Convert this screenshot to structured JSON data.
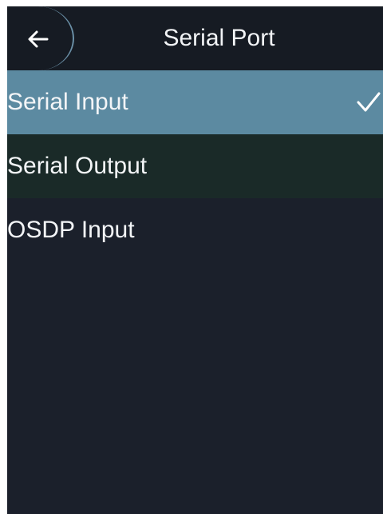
{
  "header": {
    "title": "Serial Port",
    "back_icon": "back-arrow-icon"
  },
  "list": {
    "items": [
      {
        "label": "Serial Input",
        "selected": true
      },
      {
        "label": "Serial Output",
        "selected": false
      },
      {
        "label": "OSDP Input",
        "selected": false
      }
    ],
    "check_icon": "checkmark-icon"
  },
  "colors": {
    "screen_bg": "#1b202b",
    "header_bg": "#161b23",
    "selected_bg": "#5c8aa1",
    "second_row_bg": "#1a2a28",
    "text": "#f3f5f7"
  }
}
